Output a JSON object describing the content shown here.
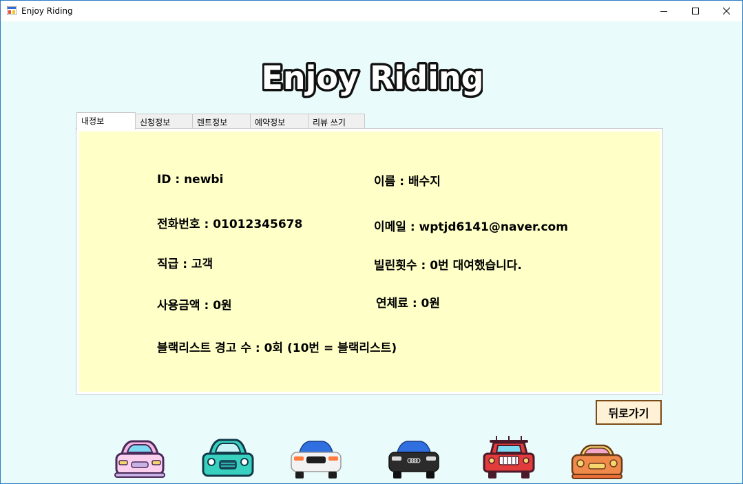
{
  "window": {
    "title": "Enjoy Riding"
  },
  "logo": {
    "text": "Enjoy Riding"
  },
  "tabs": [
    {
      "label": "내정보",
      "active": true
    },
    {
      "label": "신청정보",
      "active": false
    },
    {
      "label": "렌트정보",
      "active": false
    },
    {
      "label": "예약정보",
      "active": false
    },
    {
      "label": "리뷰 쓰기",
      "active": false
    }
  ],
  "profile": {
    "id": "ID : newbi",
    "name": "이름 : 배수지",
    "phone": "전화번호 : 01012345678",
    "email": "이메일 : wptjd6141@naver.com",
    "rank": "직급 : 고객",
    "rent_count": "빌린횟수 : 0번 대여했습니다.",
    "amount_used": "사용금액 : 0원",
    "late_fee": "연체료 : 0원",
    "blacklist": "블랙리스트 경고 수 : 0회 (10번 = 블랙리스트)"
  },
  "back_button": {
    "label": "뒤로가기"
  },
  "colors": {
    "window_background": "#eafbfb",
    "panel_background": "#ffffc8",
    "back_button_border": "#7a4a16",
    "back_button_background": "#fff1d6"
  },
  "icons": {
    "cars": [
      "pink-car-icon",
      "teal-car-icon",
      "white-car-icon",
      "black-car-icon",
      "red-jeep-icon",
      "orange-car-icon"
    ]
  }
}
